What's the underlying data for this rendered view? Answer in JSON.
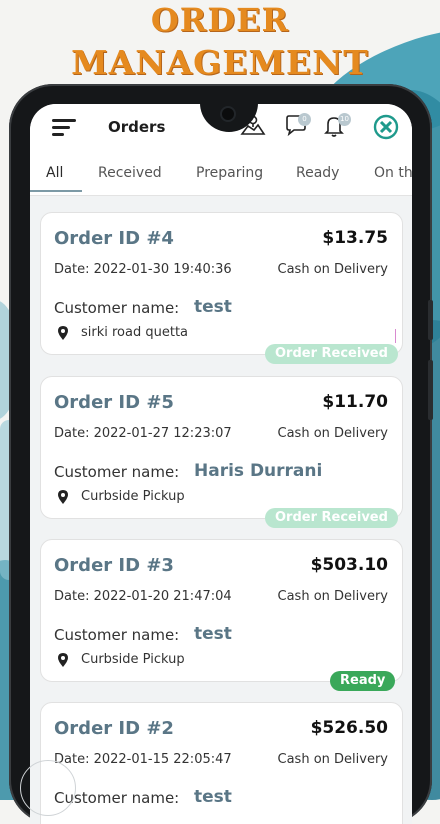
{
  "promo": {
    "line1": "ORDER",
    "line2": "MANAGEMENT"
  },
  "app": {
    "title": "Orders",
    "notifications": {
      "messages": "0",
      "alerts": "10"
    }
  },
  "tabs": [
    "All",
    "Received",
    "Preparing",
    "Ready",
    "On th"
  ],
  "labels": {
    "date_prefix": "Date:",
    "customer_label": "Customer name:"
  },
  "orders": [
    {
      "id": "Order ID #4",
      "total": "$13.75",
      "date": "Date: 2022-01-30 19:40:36",
      "payment": "Cash on Delivery",
      "customer": "test",
      "address": "sirki road quetta",
      "status": "Order Received"
    },
    {
      "id": "Order ID #5",
      "total": "$11.70",
      "date": "Date: 2022-01-27 12:23:07",
      "payment": "Cash on Delivery",
      "customer": "Haris Durrani",
      "address": "Curbside Pickup",
      "status": "Order Received"
    },
    {
      "id": "Order ID #3",
      "total": "$503.10",
      "date": "Date: 2022-01-20 21:47:04",
      "payment": "Cash on Delivery",
      "customer": "test",
      "address": "Curbside Pickup",
      "status": "Ready"
    },
    {
      "id": "Order ID #2",
      "total": "$526.50",
      "date": "Date: 2022-01-15 22:05:47",
      "payment": "Cash on Delivery",
      "customer": "test",
      "address": "",
      "status": ""
    }
  ],
  "colors": {
    "headline": "#e58a1f",
    "paint": "#2f8aa1",
    "order_id": "#5a7686",
    "status_received": "#b9e6cf",
    "status_ready": "#3aa85a"
  },
  "icons": {
    "menu": "hamburger-icon",
    "map": "map-pin-icon",
    "chat": "chat-icon",
    "bell": "bell-icon",
    "close": "close-circle-icon",
    "location": "location-pin-icon"
  }
}
